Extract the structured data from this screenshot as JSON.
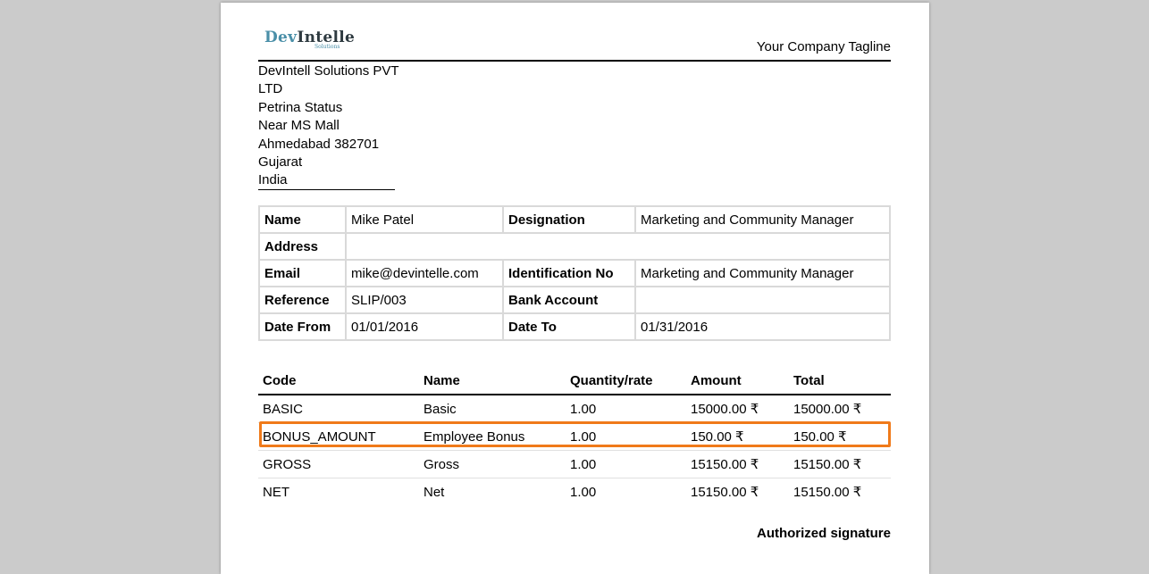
{
  "logo": {
    "dev": "Dev",
    "intelle": "Intelle",
    "sub": "Solutions"
  },
  "tagline": "Your Company Tagline",
  "address": [
    "DevIntell Solutions PVT",
    "LTD",
    "Petrina Status",
    "Near MS Mall",
    "Ahmedabad 382701",
    "Gujarat",
    "India"
  ],
  "employee": {
    "name_label": "Name",
    "name": "Mike Patel",
    "designation_label": "Designation",
    "designation": "Marketing and Community Manager",
    "address_label": "Address",
    "address": "",
    "email_label": "Email",
    "email": "mike@devintelle.com",
    "idno_label": "Identification No",
    "idno": "Marketing and Community Manager",
    "reference_label": "Reference",
    "reference": "SLIP/003",
    "bank_label": "Bank Account",
    "bank": "",
    "from_label": "Date From",
    "from": "01/01/2016",
    "to_label": "Date To",
    "to": "01/31/2016"
  },
  "lines": {
    "headers": {
      "code": "Code",
      "name": "Name",
      "qty": "Quantity/rate",
      "amount": "Amount",
      "total": "Total"
    },
    "rows": [
      {
        "code": "BASIC",
        "name": "Basic",
        "qty": "1.00",
        "amount": "15000.00 ₹",
        "total": "15000.00 ₹"
      },
      {
        "code": "BONUS_AMOUNT",
        "name": "Employee Bonus",
        "qty": "1.00",
        "amount": "150.00 ₹",
        "total": "150.00 ₹"
      },
      {
        "code": "GROSS",
        "name": "Gross",
        "qty": "1.00",
        "amount": "15150.00 ₹",
        "total": "15150.00 ₹"
      },
      {
        "code": "NET",
        "name": "Net",
        "qty": "1.00",
        "amount": "15150.00 ₹",
        "total": "15150.00 ₹"
      }
    ]
  },
  "signature": "Authorized signature",
  "highlight_color": "#f07a1a"
}
